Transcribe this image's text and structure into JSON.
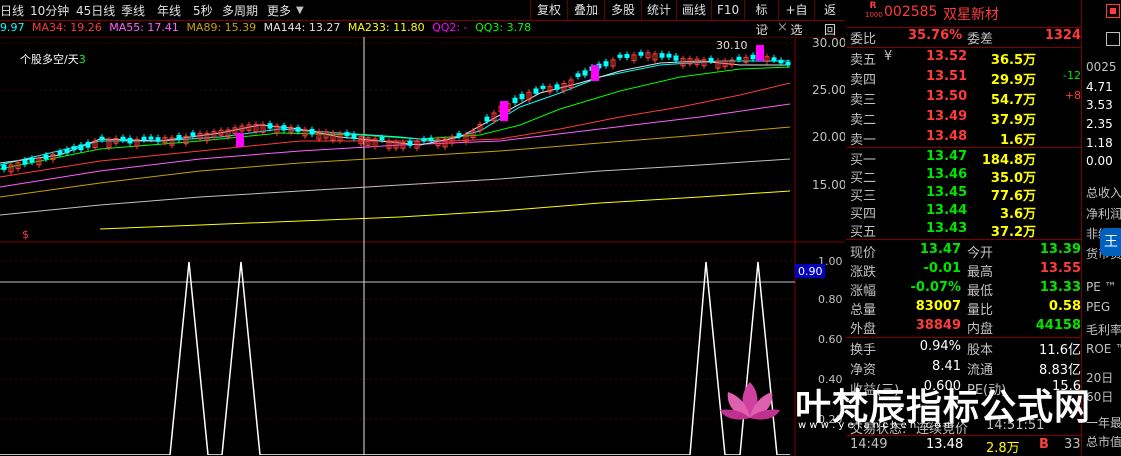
{
  "periods": [
    "日线",
    "10分钟",
    "45日线",
    "季线",
    "年线",
    "5秒",
    "多周期",
    "更多"
  ],
  "toolbar": [
    "复权",
    "叠加",
    "多股",
    "统计",
    "画线",
    "F10",
    "标记",
    "+自选",
    "返回"
  ],
  "ma_bar": [
    {
      "label": "9.97",
      "color": "#00ffff"
    },
    {
      "label": "MA34: 19.26",
      "color": "#ff3b3b"
    },
    {
      "label": "MA55: 17.41",
      "color": "#ff60ff"
    },
    {
      "label": "MA89: 15.39",
      "color": "#c8a000"
    },
    {
      "label": "MA144: 13.27",
      "color": "#e0e0e0"
    },
    {
      "label": "MA233: 11.80",
      "color": "#ffff00"
    },
    {
      "label": "QQ2: -",
      "color": "#ff00ff"
    },
    {
      "label": "QQ3: 3.78",
      "color": "#00ff00"
    }
  ],
  "indicator_label": "个股多空/天",
  "indicator_label_num": "3",
  "high_annotation": "30.10",
  "signal_mark": "$",
  "price_axis": [
    "30.00",
    "25.00",
    "20.00",
    "15.00"
  ],
  "sub_axis": [
    "1.00",
    "0.90",
    "0.80",
    "0.60",
    "0.40",
    "0.20"
  ],
  "sub_current": "0.90",
  "stock": {
    "badge_top": "R",
    "badge_bottom": "1000",
    "code": "002585",
    "name": "双星新材"
  },
  "weibi": {
    "label1": "委比",
    "value1": "35.76%",
    "label2": "委差",
    "value2": "1324"
  },
  "asks": [
    {
      "label": "卖五",
      "mark": "¥",
      "price": "13.52",
      "vol": "36.5万",
      "chg": ""
    },
    {
      "label": "卖四",
      "mark": "",
      "price": "13.51",
      "vol": "29.9万",
      "chg": "-12"
    },
    {
      "label": "卖三",
      "mark": "",
      "price": "13.50",
      "vol": "54.7万",
      "chg": "+8"
    },
    {
      "label": "卖二",
      "mark": "",
      "price": "13.49",
      "vol": "37.9万",
      "chg": ""
    },
    {
      "label": "卖一",
      "mark": "",
      "price": "13.48",
      "vol": "1.6万",
      "chg": ""
    }
  ],
  "bids": [
    {
      "label": "买一",
      "price": "13.47",
      "vol": "184.8万"
    },
    {
      "label": "买二",
      "price": "13.46",
      "vol": "35.0万"
    },
    {
      "label": "买三",
      "price": "13.45",
      "vol": "77.6万"
    },
    {
      "label": "买四",
      "price": "13.44",
      "vol": "3.6万"
    },
    {
      "label": "买五",
      "price": "13.43",
      "vol": "37.2万"
    }
  ],
  "quote": [
    {
      "l1": "现价",
      "v1": "13.47",
      "c1": "green",
      "l2": "今开",
      "v2": "13.39",
      "c2": "green"
    },
    {
      "l1": "涨跌",
      "v1": "-0.01",
      "c1": "green",
      "l2": "最高",
      "v2": "13.55",
      "c2": "red"
    },
    {
      "l1": "涨幅",
      "v1": "-0.07%",
      "c1": "green",
      "l2": "最低",
      "v2": "13.33",
      "c2": "green"
    },
    {
      "l1": "总量",
      "v1": "83007",
      "c1": "yellow",
      "l2": "量比",
      "v2": "0.58",
      "c2": "yellow"
    },
    {
      "l1": "外盘",
      "v1": "38849",
      "c1": "red",
      "l2": "内盘",
      "v2": "44158",
      "c2": "green"
    }
  ],
  "fundamentals": [
    {
      "l1": "换手",
      "v1": "0.94%",
      "l2": "股本",
      "v2": "11.6亿"
    },
    {
      "l1": "净资",
      "v1": "8.41",
      "l2": "流通",
      "v2": "8.83亿"
    },
    {
      "l1": "收益(三)",
      "v1": "0.600",
      "l2": "PE(动)",
      "v2": "15.6"
    }
  ],
  "status_row": {
    "label": "交易状态:",
    "value": "连续竞价",
    "time": "14:51:51"
  },
  "tick": {
    "time": "14:49",
    "price": "13.48",
    "vol": "2.8万",
    "side": "B",
    "num": "33"
  },
  "far_right": {
    "code": "0025",
    "prices": [
      "4.71",
      "3.53",
      "2.35",
      "1.18",
      "0.00"
    ],
    "labels": [
      "总收入",
      "净利润",
      "非经常",
      "货币资",
      "PE ™",
      "PEG",
      "毛利率",
      "ROE ™",
      "20日",
      "60日",
      "一年最高",
      "总市值"
    ]
  },
  "watermark": "叶梵辰指标公式网",
  "watermark_sub": "w w w . y e f a n c h e n . c o m",
  "chart_data": {
    "type": "candlestick",
    "price_axis_ticks": [
      30.0,
      25.0,
      20.0,
      15.0
    ],
    "high_annotation": 30.1,
    "ma_lines": [
      "MA34",
      "MA55",
      "MA89",
      "MA144",
      "MA233"
    ],
    "indicator": {
      "name": "个股多空/天",
      "ticks": [
        1.0,
        0.9,
        0.8,
        0.6,
        0.4,
        0.2
      ],
      "current": 0.9,
      "spikes": 4
    }
  }
}
